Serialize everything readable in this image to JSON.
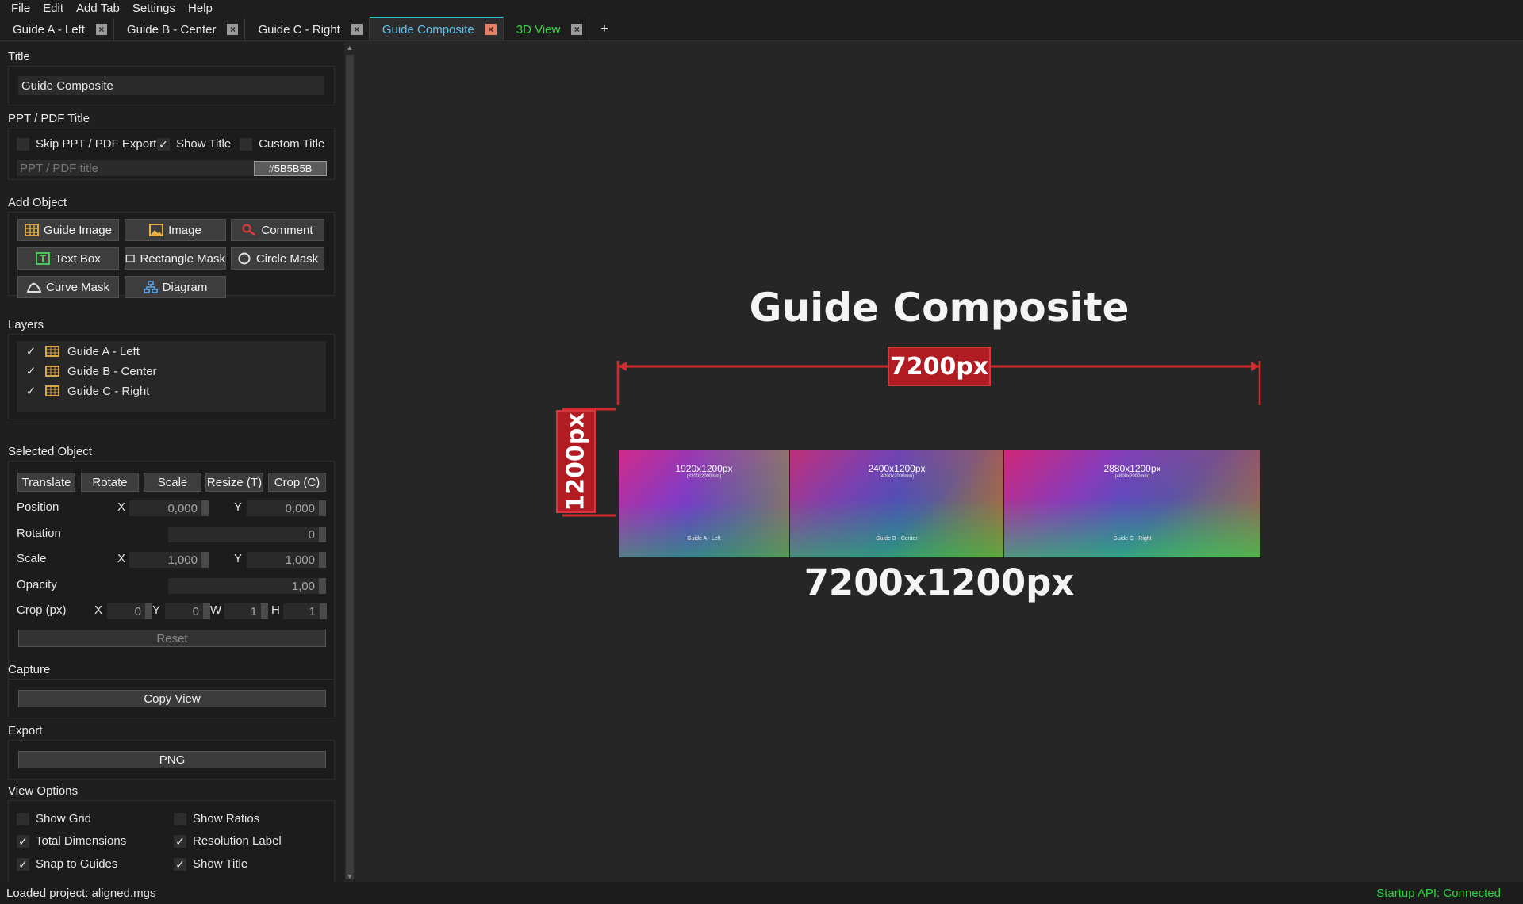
{
  "menu": [
    "File",
    "Edit",
    "Add Tab",
    "Settings",
    "Help"
  ],
  "tabs": [
    {
      "label": "Guide A - Left",
      "state": "normal"
    },
    {
      "label": "Guide B - Center",
      "state": "normal"
    },
    {
      "label": "Guide C - Right",
      "state": "normal"
    },
    {
      "label": "Guide Composite",
      "state": "active"
    },
    {
      "label": "3D View",
      "state": "green"
    }
  ],
  "add_tab_label": "+",
  "sidebar": {
    "title_section": "Title",
    "title_value": "Guide Composite",
    "ppt_section": "PPT / PDF Title",
    "skip_export": "Skip PPT / PDF Export",
    "show_title": "Show Title",
    "custom_title": "Custom Title",
    "ppt_placeholder": "PPT / PDF title",
    "color_hex": "#5B5B5B",
    "add_object_section": "Add Object",
    "add_buttons": {
      "guide_image": "Guide Image",
      "image": "Image",
      "comment": "Comment",
      "text_box": "Text Box",
      "rectangle_mask": "Rectangle Mask",
      "circle_mask": "Circle Mask",
      "curve_mask": "Curve Mask",
      "diagram": "Diagram"
    },
    "layers_section": "Layers",
    "layers": [
      "Guide A - Left",
      "Guide B - Center",
      "Guide C - Right"
    ],
    "selected_section": "Selected Object",
    "modes": [
      "Translate",
      "Rotate",
      "Scale",
      "Resize (T)",
      "Crop (C)"
    ],
    "position_label": "Position",
    "rotation_label": "Rotation",
    "scale_label": "Scale",
    "opacity_label": "Opacity",
    "crop_label": "Crop (px)",
    "axis_x": "X",
    "axis_y": "Y",
    "axis_w": "W",
    "axis_h": "H",
    "pos_x": "0,000",
    "pos_y": "0,000",
    "rotation": "0",
    "scale_x": "1,000",
    "scale_y": "1,000",
    "opacity": "1,00",
    "crop_x": "0",
    "crop_y": "0",
    "crop_w": "1",
    "crop_h": "1",
    "reset": "Reset",
    "capture_section": "Capture",
    "copy_view": "Copy View",
    "export_section": "Export",
    "png": "PNG",
    "view_section": "View Options",
    "show_grid": "Show Grid",
    "show_ratios": "Show Ratios",
    "total_dimensions": "Total Dimensions",
    "resolution_label": "Resolution Label",
    "snap_to_guides": "Snap to Guides",
    "show_title_view": "Show Title"
  },
  "canvas": {
    "title": "Guide Composite",
    "width_label": "7200px",
    "height_label": "1200px",
    "resolution": "7200x1200px",
    "panels": [
      {
        "res": "1920x1200px",
        "sub": "(3200x2000mm)",
        "name": "Guide A - Left"
      },
      {
        "res": "2400x1200px",
        "sub": "(4000x2000mm)",
        "name": "Guide B - Center"
      },
      {
        "res": "2880x1200px",
        "sub": "(4800x2000mm)",
        "name": "Guide C - Right"
      }
    ]
  },
  "status": {
    "left": "Loaded project: aligned.mgs",
    "right": "Startup API: Connected"
  },
  "colors": {
    "accent_red": "#b01c22",
    "active_tab": "#5cc3f0",
    "status_green": "#2bd43b"
  }
}
